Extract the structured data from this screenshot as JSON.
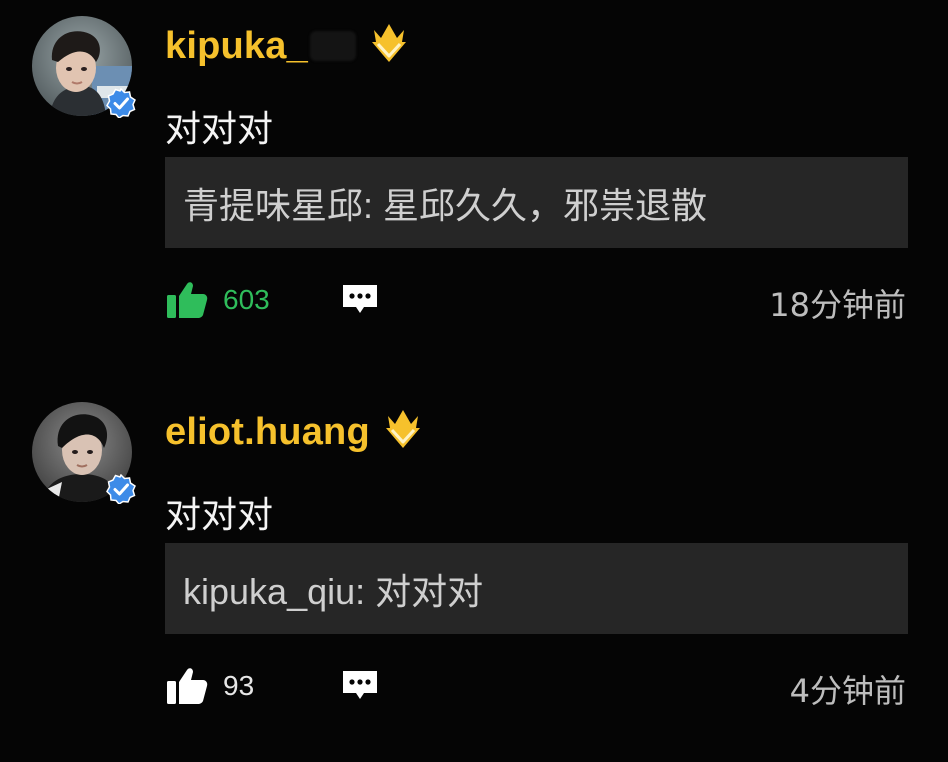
{
  "colors": {
    "background": "#050505",
    "username": "#f6c12c",
    "quote_bg": "#262626",
    "liked_green": "#2fbd5b",
    "verified_blue": "#3d8be8",
    "crown_gold": "#f6c12c"
  },
  "comments": [
    {
      "username": "kipuka_",
      "username_obscured": true,
      "badge_icon": "crown-icon",
      "verified_icon": "verified-check-icon",
      "text": "对对对",
      "quote": "青提味星邱: 星邱久久，邪祟退散",
      "likes": "603",
      "liked": true,
      "reply_icon": "comment-bubble-icon",
      "time": "18分钟前"
    },
    {
      "username": "eliot.huang",
      "username_obscured": false,
      "badge_icon": "crown-icon",
      "verified_icon": "verified-check-icon",
      "text": "对对对",
      "quote": "kipuka_qiu: 对对对",
      "likes": "93",
      "liked": false,
      "reply_icon": "comment-bubble-icon",
      "time": "4分钟前"
    }
  ]
}
